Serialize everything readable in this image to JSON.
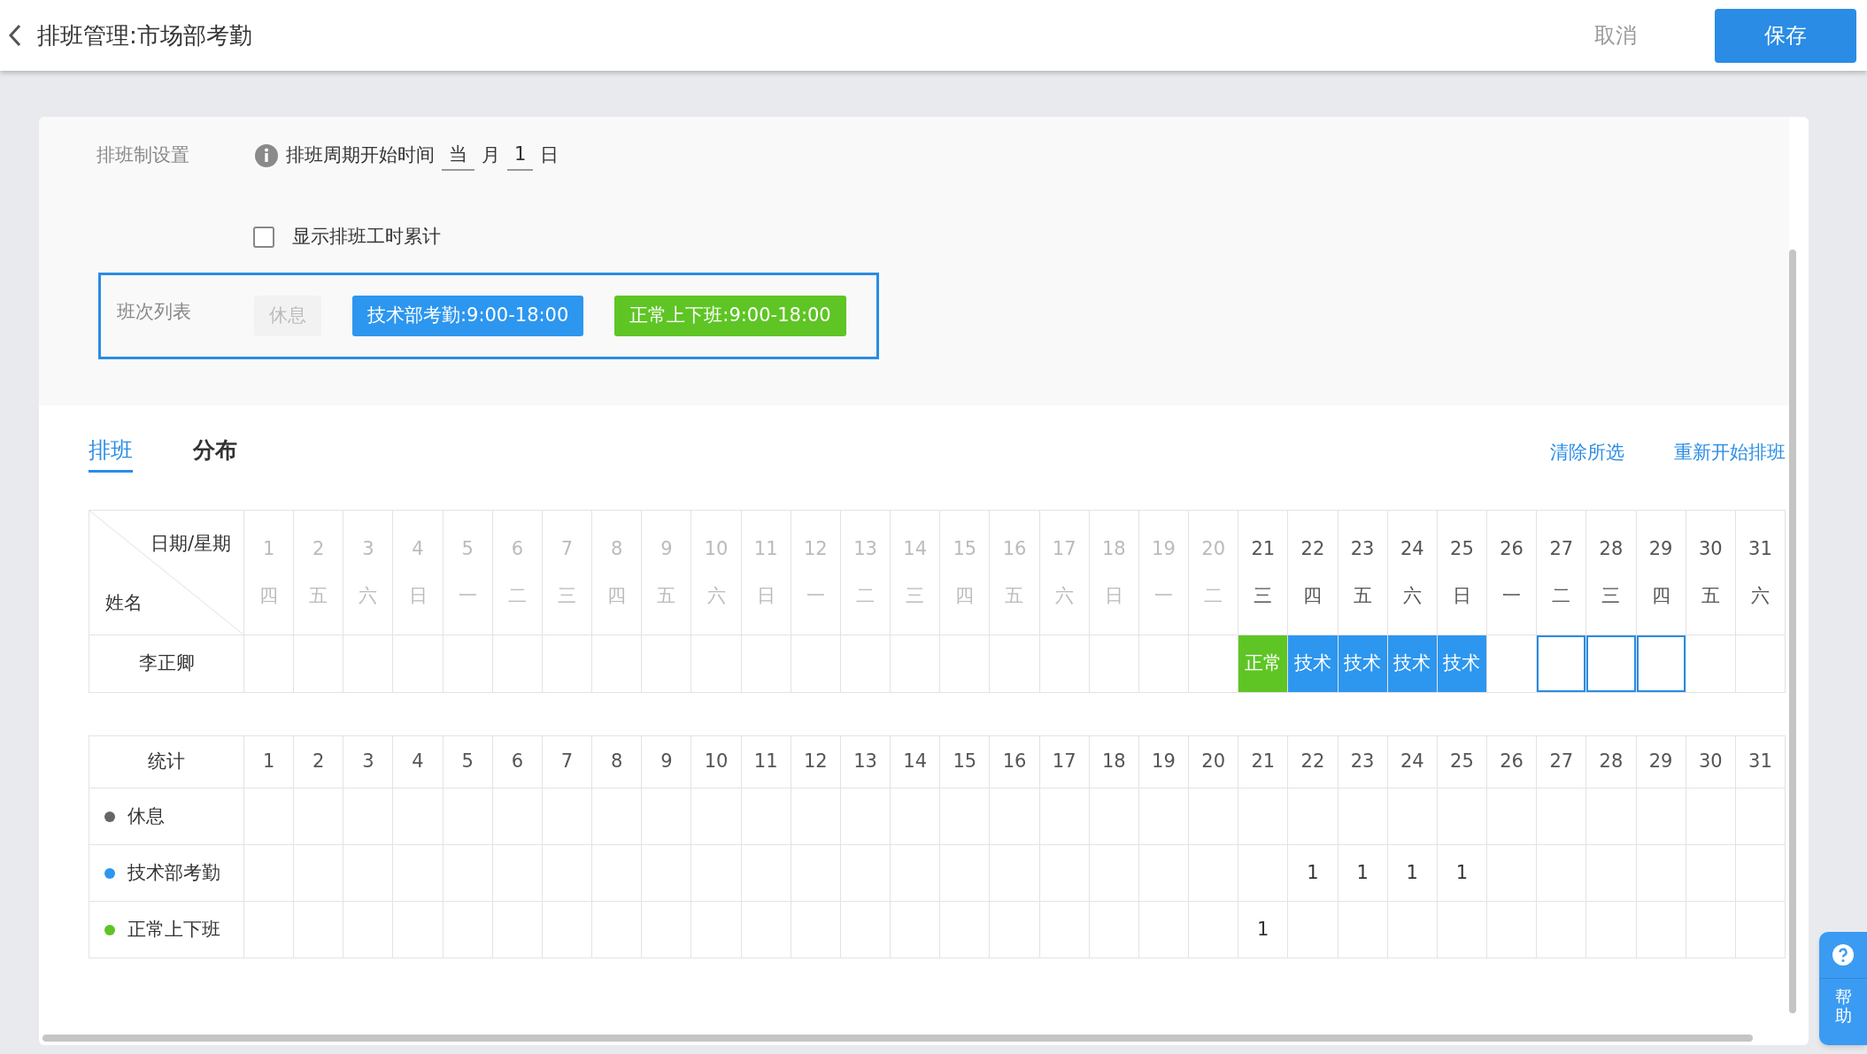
{
  "header": {
    "title": "排班管理:市场部考勤",
    "cancel": "取消",
    "save": "保存"
  },
  "settings": {
    "label": "排班制设置",
    "cycle_label": "排班周期开始时间",
    "month_value": "当",
    "month_unit": "月",
    "day_value": "1",
    "day_unit": "日",
    "show_hours": {
      "label": "显示排班工时累计",
      "checked": false
    }
  },
  "shift_list": {
    "label": "班次列表",
    "shifts": [
      {
        "label": "休息",
        "kind": "rest",
        "color": "#f2f2f2"
      },
      {
        "label": "技术部考勤:9:00-18:00",
        "kind": "shift",
        "color": "#2d96ef"
      },
      {
        "label": "正常上下班:9:00-18:00",
        "kind": "shift",
        "color": "#5ec524"
      }
    ]
  },
  "tabs": [
    {
      "label": "排班",
      "selected": true
    },
    {
      "label": "分布",
      "selected": false
    }
  ],
  "actions": [
    "清除所选",
    "重新开始排班"
  ],
  "schedule": {
    "corner_top": "日期/星期",
    "corner_bottom": "姓名",
    "days": [
      {
        "date": "1",
        "weekday": "四",
        "past": true
      },
      {
        "date": "2",
        "weekday": "五",
        "past": true
      },
      {
        "date": "3",
        "weekday": "六",
        "past": true
      },
      {
        "date": "4",
        "weekday": "日",
        "past": true
      },
      {
        "date": "5",
        "weekday": "一",
        "past": true
      },
      {
        "date": "6",
        "weekday": "二",
        "past": true
      },
      {
        "date": "7",
        "weekday": "三",
        "past": true
      },
      {
        "date": "8",
        "weekday": "四",
        "past": true
      },
      {
        "date": "9",
        "weekday": "五",
        "past": true
      },
      {
        "date": "10",
        "weekday": "六",
        "past": true
      },
      {
        "date": "11",
        "weekday": "日",
        "past": true
      },
      {
        "date": "12",
        "weekday": "一",
        "past": true
      },
      {
        "date": "13",
        "weekday": "二",
        "past": true
      },
      {
        "date": "14",
        "weekday": "三",
        "past": true
      },
      {
        "date": "15",
        "weekday": "四",
        "past": true
      },
      {
        "date": "16",
        "weekday": "五",
        "past": true
      },
      {
        "date": "17",
        "weekday": "六",
        "past": true
      },
      {
        "date": "18",
        "weekday": "日",
        "past": true
      },
      {
        "date": "19",
        "weekday": "一",
        "past": true
      },
      {
        "date": "20",
        "weekday": "二",
        "past": true
      },
      {
        "date": "21",
        "weekday": "三",
        "past": false
      },
      {
        "date": "22",
        "weekday": "四",
        "past": false
      },
      {
        "date": "23",
        "weekday": "五",
        "past": false
      },
      {
        "date": "24",
        "weekday": "六",
        "past": false
      },
      {
        "date": "25",
        "weekday": "日",
        "past": false
      },
      {
        "date": "26",
        "weekday": "一",
        "past": false
      },
      {
        "date": "27",
        "weekday": "二",
        "past": false
      },
      {
        "date": "28",
        "weekday": "三",
        "past": false
      },
      {
        "date": "29",
        "weekday": "四",
        "past": false
      },
      {
        "date": "30",
        "weekday": "五",
        "past": false
      },
      {
        "date": "31",
        "weekday": "六",
        "past": false
      }
    ],
    "rows": [
      {
        "name": "李正卿",
        "cells": [
          {
            "selected": false
          },
          {
            "selected": false
          },
          {
            "selected": false
          },
          {
            "selected": false
          },
          {
            "selected": false
          },
          {
            "selected": false
          },
          {
            "selected": false
          },
          {
            "selected": false
          },
          {
            "selected": false
          },
          {
            "selected": false
          },
          {
            "selected": false
          },
          {
            "selected": false
          },
          {
            "selected": false
          },
          {
            "selected": false
          },
          {
            "selected": false
          },
          {
            "selected": false
          },
          {
            "selected": false
          },
          {
            "selected": false
          },
          {
            "selected": false
          },
          {
            "selected": false
          },
          {
            "text": "正常",
            "color": "#5ec524",
            "selected": false
          },
          {
            "text": "技术",
            "color": "#2d96ef",
            "selected": false
          },
          {
            "text": "技术",
            "color": "#2d96ef",
            "selected": false
          },
          {
            "text": "技术",
            "color": "#2d96ef",
            "selected": false
          },
          {
            "text": "技术",
            "color": "#2d96ef",
            "selected": false
          },
          {
            "selected": false
          },
          {
            "selected": true
          },
          {
            "selected": true
          },
          {
            "selected": true
          },
          {
            "selected": false
          },
          {
            "selected": false
          }
        ]
      }
    ]
  },
  "stats": {
    "title": "统计",
    "days": [
      "1",
      "2",
      "3",
      "4",
      "5",
      "6",
      "7",
      "8",
      "9",
      "10",
      "11",
      "12",
      "13",
      "14",
      "15",
      "16",
      "17",
      "18",
      "19",
      "20",
      "21",
      "22",
      "23",
      "24",
      "25",
      "26",
      "27",
      "28",
      "29",
      "30",
      "31"
    ],
    "rows": [
      {
        "name": "休息",
        "color": "#666666",
        "counts": [
          {
            "kind": "blank"
          },
          {
            "kind": "blank"
          },
          {
            "kind": "blank"
          },
          {
            "kind": "blank"
          },
          {
            "kind": "blank"
          },
          {
            "kind": "blank"
          },
          {
            "kind": "blank"
          },
          {
            "kind": "blank"
          },
          {
            "kind": "blank"
          },
          {
            "kind": "blank"
          },
          {
            "kind": "blank"
          },
          {
            "kind": "blank"
          },
          {
            "kind": "blank"
          },
          {
            "kind": "blank"
          },
          {
            "kind": "blank"
          },
          {
            "kind": "blank"
          },
          {
            "kind": "blank"
          },
          {
            "kind": "blank"
          },
          {
            "kind": "blank"
          },
          {
            "kind": "blank"
          },
          {
            "kind": "blank"
          },
          {
            "kind": "blank"
          },
          {
            "kind": "blank"
          },
          {
            "kind": "blank"
          },
          {
            "kind": "blank"
          },
          {
            "kind": "blank"
          },
          {
            "kind": "blank"
          },
          {
            "kind": "blank"
          },
          {
            "kind": "blank"
          },
          {
            "kind": "blank"
          },
          {
            "kind": "blank"
          }
        ]
      },
      {
        "name": "技术部考勤",
        "color": "#2d96ef",
        "counts": [
          {
            "kind": "blank"
          },
          {
            "kind": "blank"
          },
          {
            "kind": "blank"
          },
          {
            "kind": "blank"
          },
          {
            "kind": "blank"
          },
          {
            "kind": "blank"
          },
          {
            "kind": "blank"
          },
          {
            "kind": "blank"
          },
          {
            "kind": "blank"
          },
          {
            "kind": "blank"
          },
          {
            "kind": "blank"
          },
          {
            "kind": "blank"
          },
          {
            "kind": "blank"
          },
          {
            "kind": "blank"
          },
          {
            "kind": "blank"
          },
          {
            "kind": "blank"
          },
          {
            "kind": "blank"
          },
          {
            "kind": "blank"
          },
          {
            "kind": "blank"
          },
          {
            "kind": "blank"
          },
          {
            "kind": "blank"
          },
          {
            "kind": "count",
            "value": "1"
          },
          {
            "kind": "count",
            "value": "1"
          },
          {
            "kind": "count",
            "value": "1"
          },
          {
            "kind": "count",
            "value": "1"
          },
          {
            "kind": "blank"
          },
          {
            "kind": "blank"
          },
          {
            "kind": "blank"
          },
          {
            "kind": "blank"
          },
          {
            "kind": "blank"
          },
          {
            "kind": "blank"
          }
        ]
      },
      {
        "name": "正常上下班",
        "color": "#5ec524",
        "counts": [
          {
            "kind": "blank"
          },
          {
            "kind": "blank"
          },
          {
            "kind": "blank"
          },
          {
            "kind": "blank"
          },
          {
            "kind": "blank"
          },
          {
            "kind": "blank"
          },
          {
            "kind": "blank"
          },
          {
            "kind": "blank"
          },
          {
            "kind": "blank"
          },
          {
            "kind": "blank"
          },
          {
            "kind": "blank"
          },
          {
            "kind": "blank"
          },
          {
            "kind": "blank"
          },
          {
            "kind": "blank"
          },
          {
            "kind": "blank"
          },
          {
            "kind": "blank"
          },
          {
            "kind": "blank"
          },
          {
            "kind": "blank"
          },
          {
            "kind": "blank"
          },
          {
            "kind": "blank"
          },
          {
            "kind": "count",
            "value": "1"
          },
          {
            "kind": "blank"
          },
          {
            "kind": "blank"
          },
          {
            "kind": "blank"
          },
          {
            "kind": "blank"
          },
          {
            "kind": "blank"
          },
          {
            "kind": "blank"
          },
          {
            "kind": "blank"
          },
          {
            "kind": "blank"
          },
          {
            "kind": "blank"
          },
          {
            "kind": "blank"
          }
        ]
      }
    ]
  },
  "help": {
    "label": "帮助"
  }
}
